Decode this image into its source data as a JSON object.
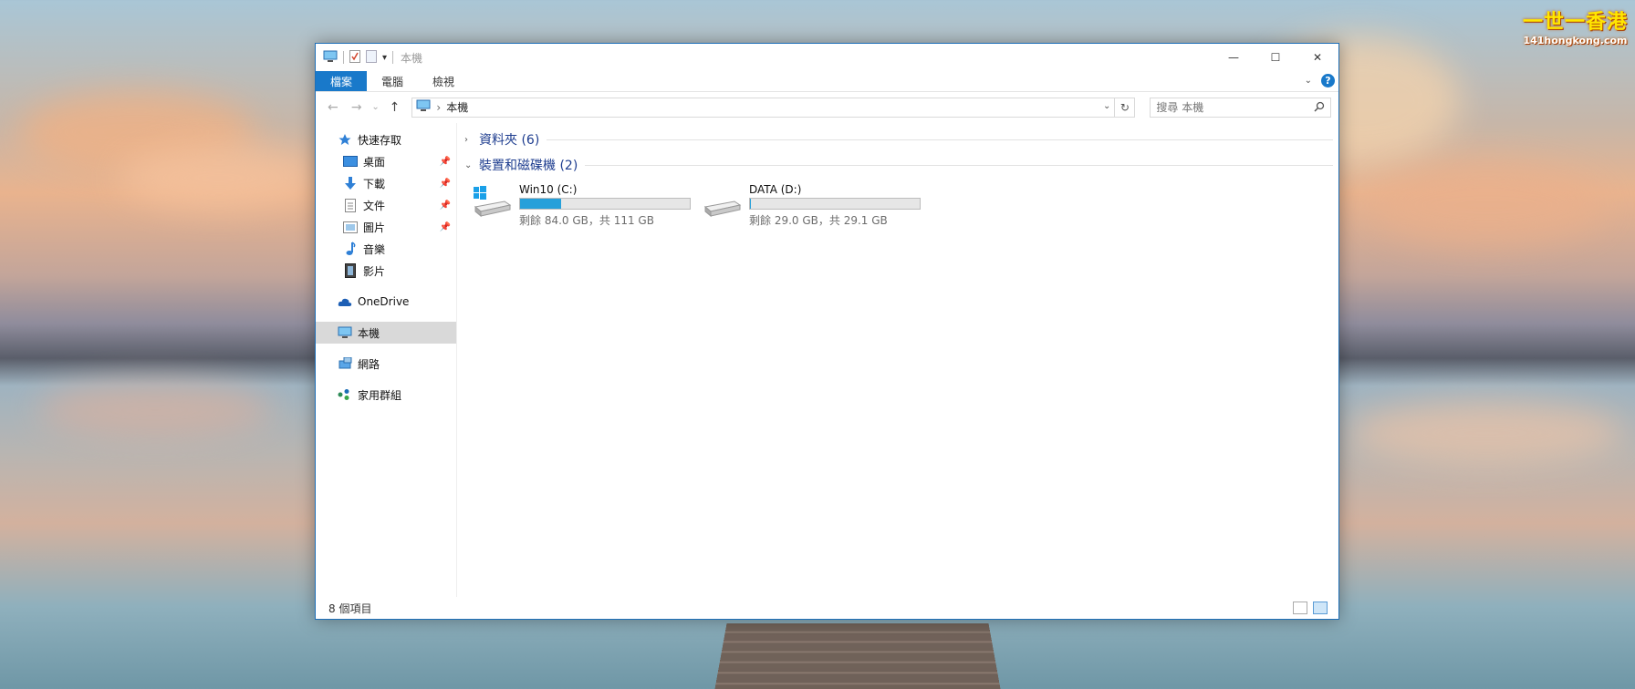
{
  "watermark": {
    "line1": "一世一香港",
    "line2": "141hongkong.com"
  },
  "window": {
    "title": "本機",
    "controls": {
      "minimize": "—",
      "maximize": "☐",
      "close": "✕"
    }
  },
  "ribbon": {
    "tabs": [
      "檔案",
      "電腦",
      "檢視"
    ],
    "help": "?"
  },
  "navbar": {
    "back": "←",
    "forward": "→",
    "recent": "⌄",
    "up": "↑",
    "address_crumb": "本機",
    "refresh": "↻",
    "search_placeholder": "搜尋 本機"
  },
  "nav_pane": {
    "quick_access": "快速存取",
    "pinned": [
      {
        "label": "桌面",
        "icon": "desktop-icon",
        "pinned": true
      },
      {
        "label": "下載",
        "icon": "download-icon",
        "pinned": true
      },
      {
        "label": "文件",
        "icon": "documents-icon",
        "pinned": true
      },
      {
        "label": "圖片",
        "icon": "pictures-icon",
        "pinned": true
      },
      {
        "label": "音樂",
        "icon": "music-icon",
        "pinned": false
      },
      {
        "label": "影片",
        "icon": "videos-icon",
        "pinned": false
      }
    ],
    "onedrive": "OneDrive",
    "this_pc": "本機",
    "network": "網路",
    "homegroup": "家用群組"
  },
  "content": {
    "folders_group": "資料夾 (6)",
    "devices_group": "裝置和磁碟機 (2)",
    "drives": [
      {
        "name": "Win10 (C:)",
        "free_text": "剩餘 84.0 GB，共 111 GB",
        "used_fraction": 0.243,
        "system": true
      },
      {
        "name": "DATA (D:)",
        "free_text": "剩餘 29.0 GB，共 29.1 GB",
        "used_fraction": 0.003,
        "system": false
      }
    ]
  },
  "status": {
    "items_count": "8 個項目"
  },
  "colors": {
    "accent": "#1979ca",
    "bar_fill": "#26a0da",
    "group_text": "#1e3d8f"
  }
}
